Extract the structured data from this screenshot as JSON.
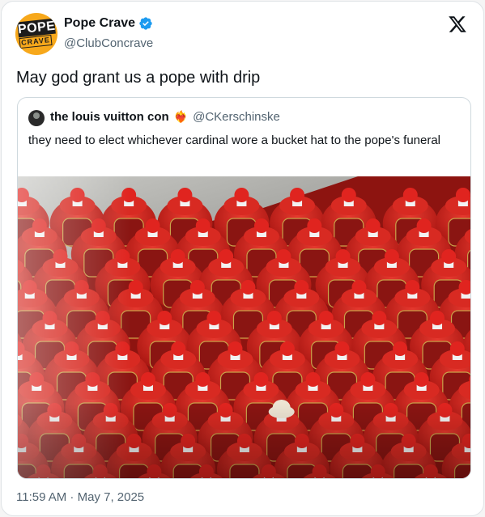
{
  "author": {
    "display_name": "Pope Crave",
    "handle": "@ClubConcrave",
    "avatar_top": "POPE",
    "avatar_bottom": "CRAVE",
    "verified": true,
    "verified_color": "#1d9bf0"
  },
  "tweet": {
    "text": "May god grant us a pope with drip",
    "timestamp": "11:59 AM · May 7, 2025"
  },
  "quoted": {
    "display_name": "the louis vuitton con",
    "name_emoji": "❤️‍🔥",
    "handle": "@CKerschinske",
    "text": "they need to elect whichever cardinal wore a bucket hat to the pope's funeral",
    "photo_icon": "cardinals-crowd-photo"
  },
  "colors": {
    "cardinal_red": "#c8201e",
    "zucchetto_red": "#e0241f",
    "pavement": "#a9a9a5",
    "bucket_hat": "#ede4d3"
  },
  "icons": {
    "platform": "x-logo-icon",
    "verified": "verified-badge-icon"
  }
}
